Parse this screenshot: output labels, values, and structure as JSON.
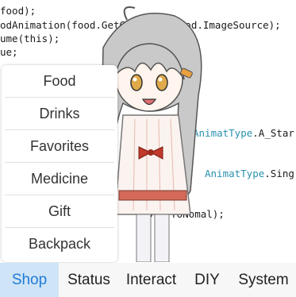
{
  "code_lines": [
    {
      "text": "food);"
    },
    {
      "text": "odAnimation(food.GetGraph(), food.ImageSource);"
    },
    {
      "text": "ume(this);"
    },
    {
      "text": "ue;"
    },
    {
      "pre": "",
      "enum": "AnimatType",
      "post": ".A_Star"
    },
    {
      "pre": "",
      "enum": "AnimatType",
      "post": ".Sing"
    },
    {
      "text": "playToNomal);"
    }
  ],
  "menu": {
    "items": [
      {
        "label": "Food"
      },
      {
        "label": "Drinks"
      },
      {
        "label": "Favorites"
      },
      {
        "label": "Medicine"
      },
      {
        "label": "Gift"
      },
      {
        "label": "Backpack"
      }
    ]
  },
  "tabs": [
    {
      "label": "Shop",
      "active": true
    },
    {
      "label": "Status"
    },
    {
      "label": "Interact"
    },
    {
      "label": "DIY"
    },
    {
      "label": "System"
    }
  ],
  "colors": {
    "accent": "#1f7ad6",
    "active_tab_bg": "#cfe5f7",
    "enum_type": "#2b91af",
    "hair": "#b9b9b9",
    "bow": "#c0392b"
  }
}
